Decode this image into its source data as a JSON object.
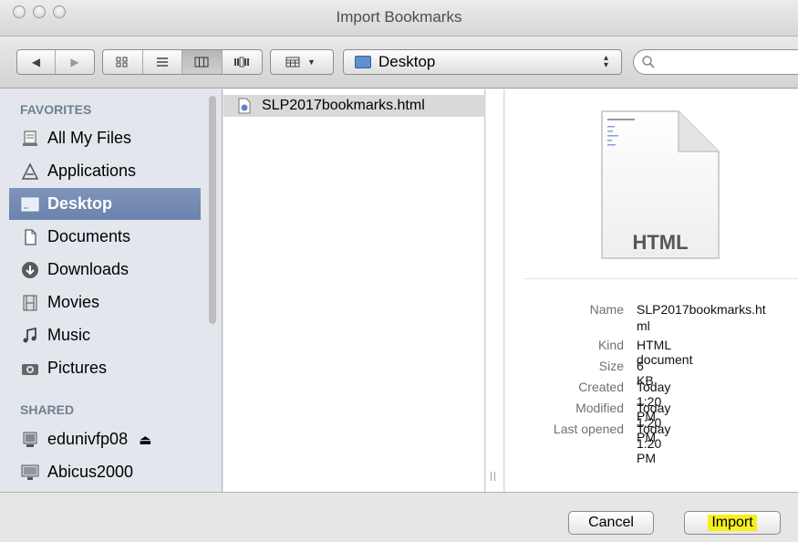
{
  "window": {
    "title": "Import Bookmarks"
  },
  "toolbar": {
    "location": "Desktop",
    "search_placeholder": ""
  },
  "sidebar": {
    "favorites_heading": "FAVORITES",
    "favorites": [
      {
        "label": "All My Files",
        "icon": "all-files-icon"
      },
      {
        "label": "Applications",
        "icon": "applications-icon"
      },
      {
        "label": "Desktop",
        "icon": "desktop-folder-icon",
        "selected": true
      },
      {
        "label": "Documents",
        "icon": "documents-icon"
      },
      {
        "label": "Downloads",
        "icon": "downloads-icon"
      },
      {
        "label": "Movies",
        "icon": "movies-icon"
      },
      {
        "label": "Music",
        "icon": "music-icon"
      },
      {
        "label": "Pictures",
        "icon": "pictures-icon"
      }
    ],
    "shared_heading": "SHARED",
    "shared": [
      {
        "label": "edunivfp08",
        "icon": "server-icon",
        "eject": "⏏"
      },
      {
        "label": "Abicus2000",
        "icon": "computer-icon"
      }
    ]
  },
  "files": [
    {
      "name": "SLP2017bookmarks.html",
      "selected": true
    }
  ],
  "preview": {
    "doc_type_label": "HTML",
    "info": [
      {
        "key": "Name",
        "value": "SLP2017bookmarks.ht"
      },
      {
        "key": "",
        "value": "ml"
      },
      {
        "key": "Kind",
        "value": "HTML document"
      },
      {
        "key": "Size",
        "value": "6 KB"
      },
      {
        "key": "Created",
        "value": "Today 1:20 PM"
      },
      {
        "key": "Modified",
        "value": "Today 1:20 PM"
      },
      {
        "key": "Last opened",
        "value": "Today 1:20 PM"
      }
    ]
  },
  "buttons": {
    "cancel": "Cancel",
    "import": "Import",
    "import_highlight": "#f5f01e"
  }
}
